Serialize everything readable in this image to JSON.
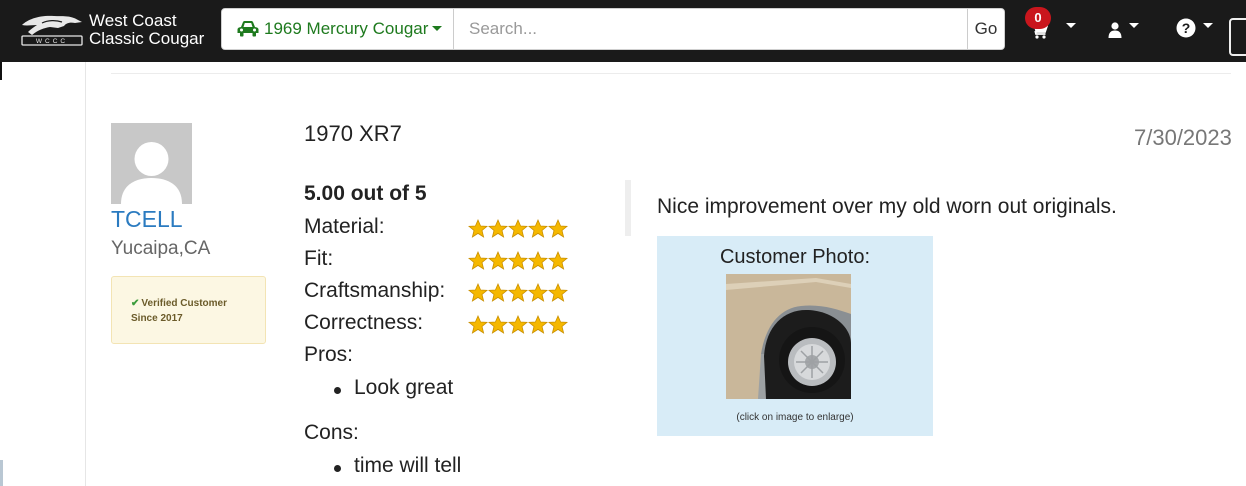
{
  "header": {
    "brand_line1": "West Coast",
    "brand_line2": "Classic Cougar",
    "logo_text": "WCCC",
    "vehicle_selector": "1969 Mercury Cougar",
    "search_placeholder": "Search...",
    "go_label": "Go",
    "cart_count": "0",
    "icons": [
      "car-icon",
      "cart-icon",
      "user-icon",
      "help-icon"
    ]
  },
  "reviewer": {
    "name": "TCELL",
    "location": "Yucaipa,CA",
    "verified_label": "Verified Customer",
    "since_label": "Since 2017"
  },
  "review": {
    "title": "1970 XR7",
    "date": "7/30/2023",
    "overall": "5.00 out of 5",
    "ratings": [
      {
        "label": "Material:",
        "stars": 5
      },
      {
        "label": "Fit:",
        "stars": 5
      },
      {
        "label": "Craftsmanship:",
        "stars": 5
      },
      {
        "label": "Correctness:",
        "stars": 5
      }
    ],
    "pros_label": "Pros:",
    "pros": [
      "Look great"
    ],
    "cons_label": "Cons:",
    "cons": [
      "time will tell"
    ],
    "comment": "Nice improvement over my old worn out originals.",
    "photo_title": "Customer Photo:",
    "photo_caption": "(click on image to enlarge)"
  },
  "colors": {
    "navbar": "#1a1a1a",
    "vehicle_green": "#1e7a1e",
    "link_blue": "#2b7bc0",
    "badge_red": "#c9161d",
    "star_gold": "#f5b800",
    "photo_bg": "#d8ecf7",
    "verified_bg": "#fcf7e3"
  }
}
